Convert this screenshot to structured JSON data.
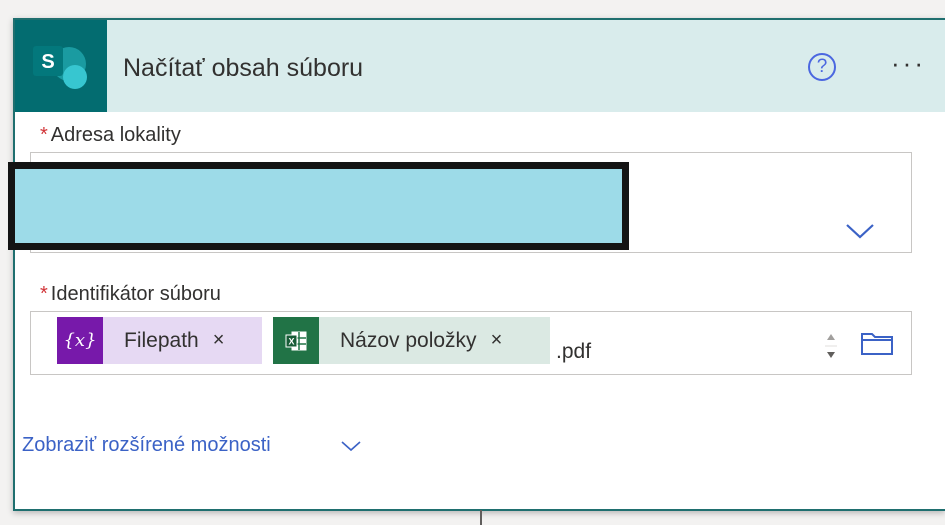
{
  "header": {
    "title": "Načítať obsah súboru",
    "help_icon": "?",
    "more_icon": "···",
    "logo_letter": "S",
    "accent": "#036c70"
  },
  "site_address": {
    "required_mark": "*",
    "label": "Adresa lokality",
    "dropdown_icon": "chevron-down-icon"
  },
  "file_identifier": {
    "required_mark": "*",
    "label": "Identifikátor súboru",
    "tokens": [
      {
        "icon": "{x}",
        "label": "Filepath",
        "remove": "×",
        "color": "#7719aa"
      },
      {
        "icon": "excel-icon",
        "label": "Názov položky",
        "remove": "×",
        "color": "#217346"
      }
    ],
    "suffix": ".pdf"
  },
  "advanced": {
    "label": "Zobraziť rozšírené možnosti"
  }
}
